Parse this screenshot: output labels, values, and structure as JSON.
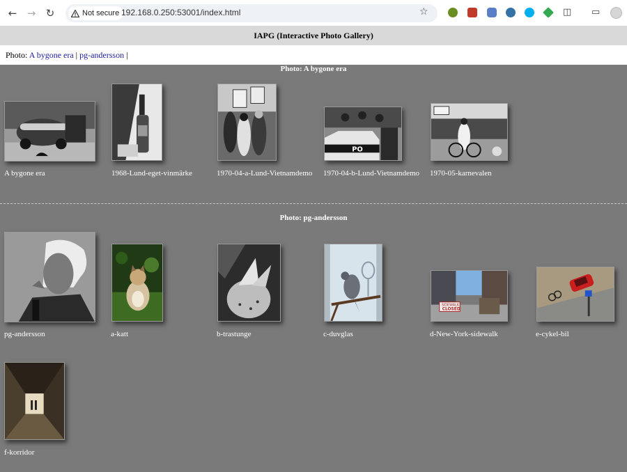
{
  "browser": {
    "security_label": "Not secure",
    "url": "192.168.0.250:53001/index.html",
    "back_icon": "arrow-left-icon",
    "forward_icon": "arrow-right-icon",
    "reload_icon": "reload-icon"
  },
  "page": {
    "title": "IAPG (Interactive Photo Gallery)",
    "nav_prefix": "Photo:",
    "nav_links": [
      "A bygone era",
      "pg-andersson"
    ],
    "nav_separator": "|"
  },
  "sections": [
    {
      "title": "Photo: A bygone era",
      "items": [
        {
          "caption": "A bygone era"
        },
        {
          "caption": "1968-Lund-eget-vinmärke"
        },
        {
          "caption": "1970-04-a-Lund-Vietnamdemo"
        },
        {
          "caption": "1970-04-b-Lund-Vietnamdemo"
        },
        {
          "caption": "1970-05-karnevalen"
        }
      ]
    },
    {
      "title": "Photo: pg-andersson",
      "items": [
        {
          "caption": "pg-andersson"
        },
        {
          "caption": "a-katt"
        },
        {
          "caption": "b-trastunge"
        },
        {
          "caption": "c-duvglas"
        },
        {
          "caption": "d-New-York-sidewalk"
        },
        {
          "caption": "e-cykel-bil"
        },
        {
          "caption": "f-korridor"
        }
      ]
    }
  ]
}
